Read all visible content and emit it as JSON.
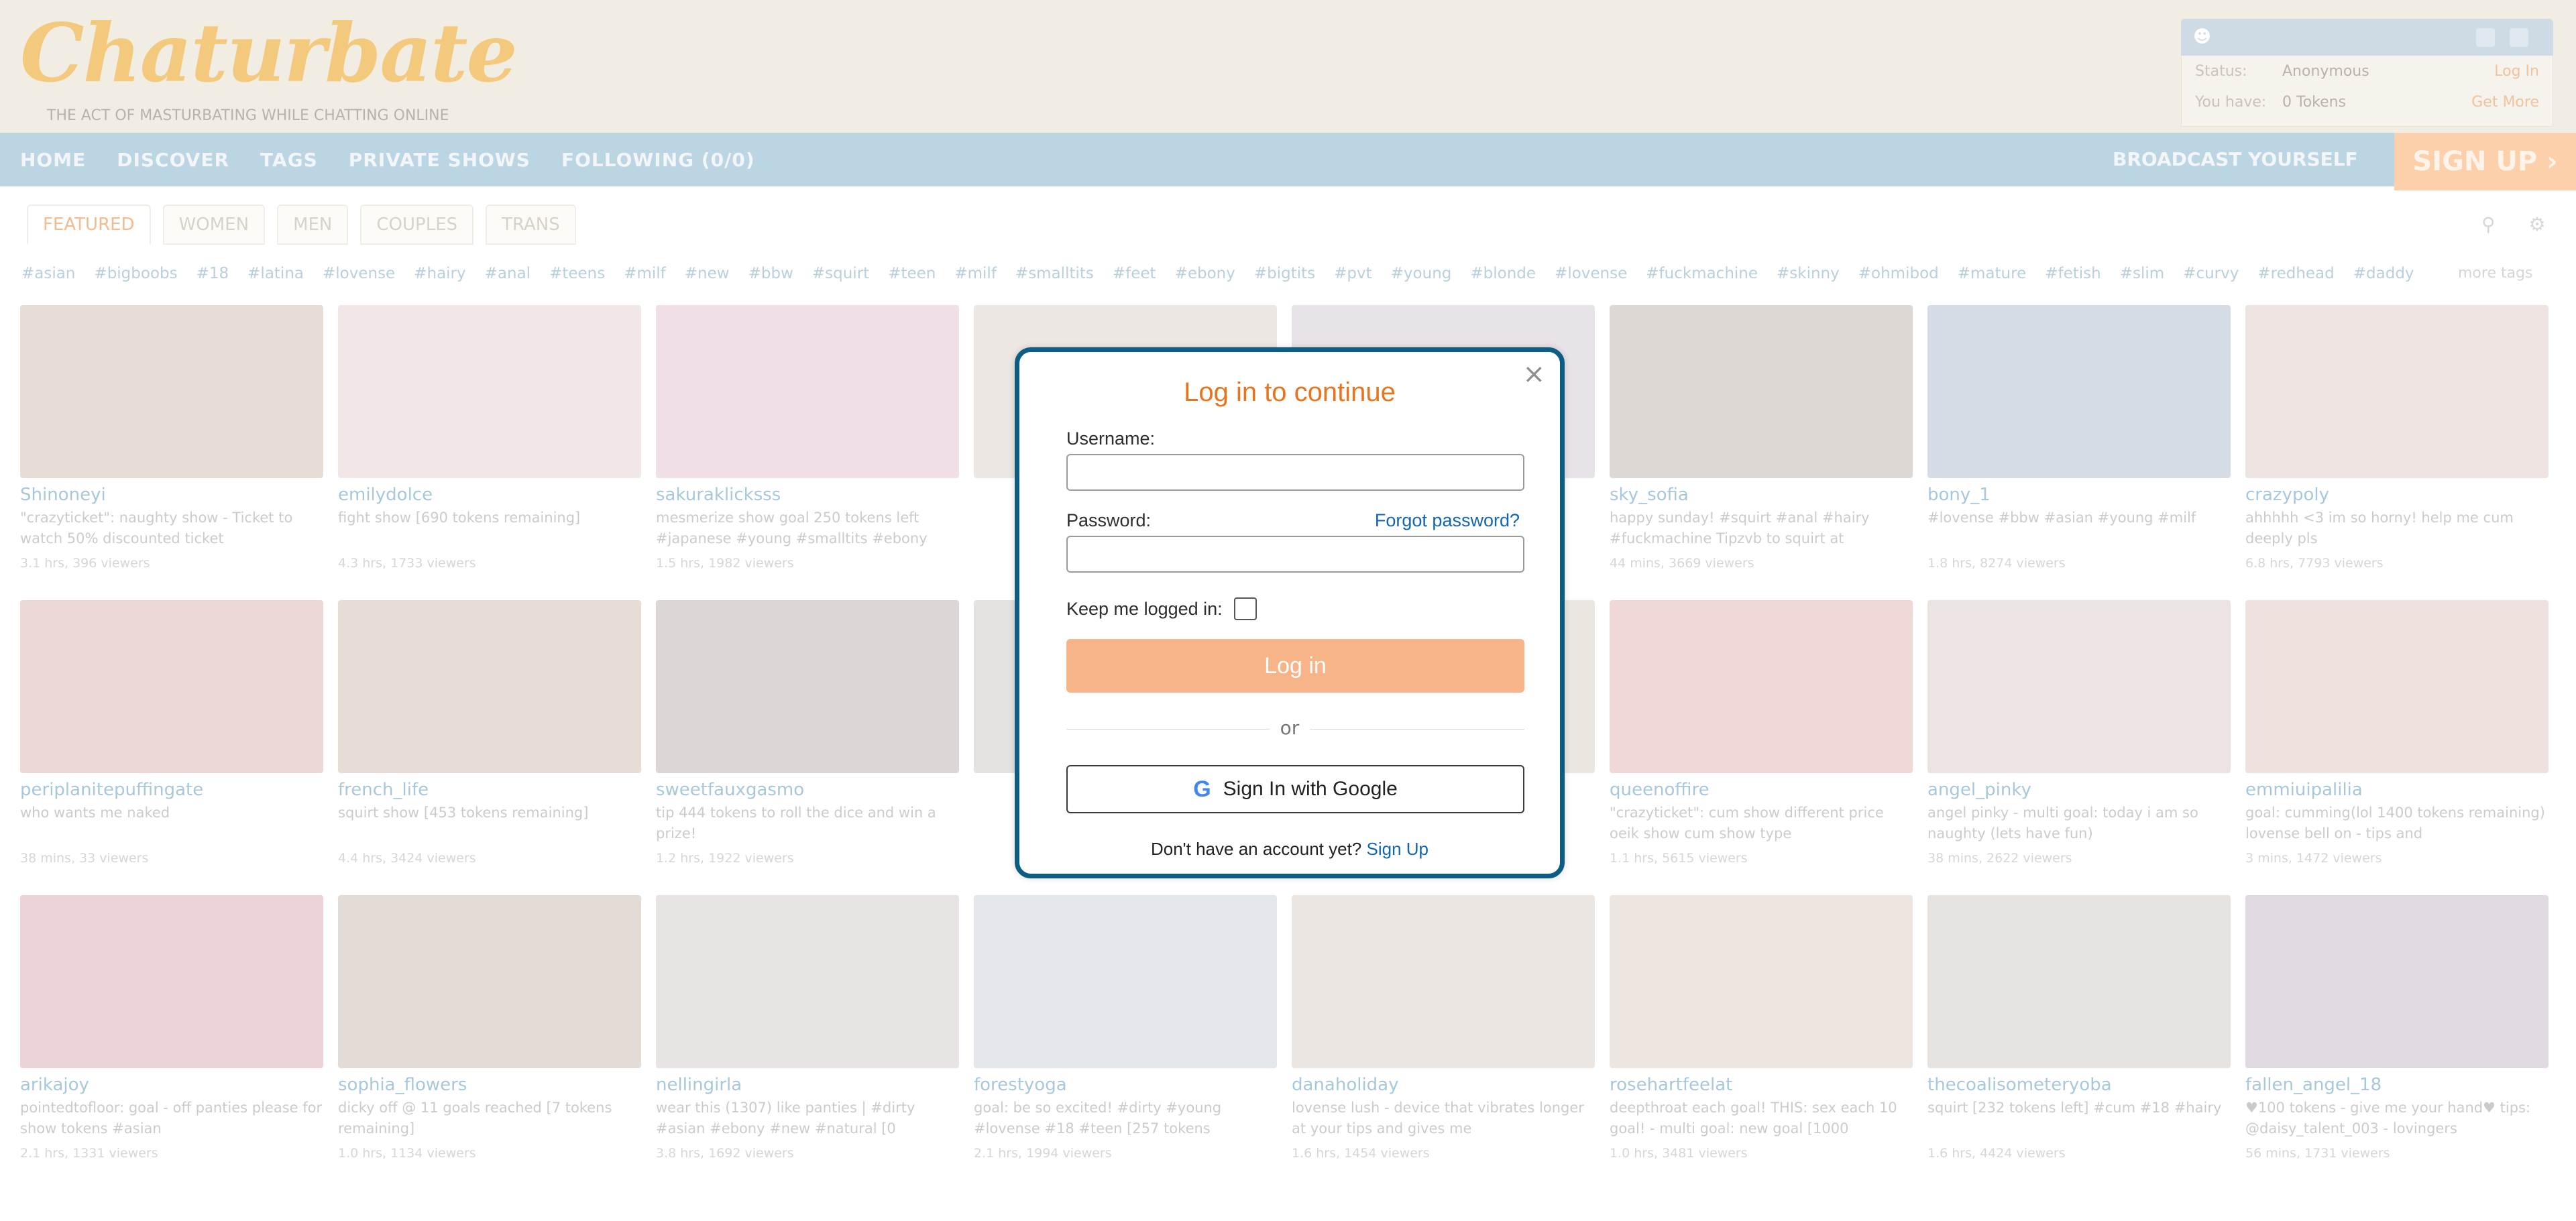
{
  "header": {
    "logo_text": "Chaturbate",
    "logo_sub": "THE ACT OF MASTURBATING WHILE CHATTING ONLINE",
    "user_rows": [
      {
        "label": "Status:",
        "value": "Anonymous",
        "action": "Log In"
      },
      {
        "label": "You have:",
        "value": "0 Tokens",
        "action": "Get More"
      }
    ]
  },
  "nav": {
    "items": [
      "HOME",
      "DISCOVER",
      "TAGS",
      "PRIVATE SHOWS",
      "FOLLOWING (0/0)"
    ],
    "broadcast": "BROADCAST YOURSELF",
    "signup": "SIGN UP ›"
  },
  "tabs": [
    "FEATURED",
    "WOMEN",
    "MEN",
    "COUPLES",
    "TRANS"
  ],
  "tags": [
    "#asian",
    "#bigboobs",
    "#18",
    "#latina",
    "#lovense",
    "#hairy",
    "#anal",
    "#teens",
    "#milf",
    "#new",
    "#bbw",
    "#squirt",
    "#teen",
    "#milf",
    "#smalltits",
    "#feet",
    "#ebony",
    "#bigtits",
    "#pvt",
    "#young",
    "#blonde",
    "#lovense",
    "#fuckmachine",
    "#skinny",
    "#ohmibod",
    "#mature",
    "#fetish",
    "#slim",
    "#curvy",
    "#redhead",
    "#daddy"
  ],
  "tags_more": "more tags",
  "rooms": [
    {
      "name": "Shinoneyi",
      "subj": "\"crazyticket\": naughty show - Ticket to watch 50% discounted ticket",
      "meta": "3.1 hrs, 396 viewers"
    },
    {
      "name": "emilydolce",
      "subj": "fight show [690 tokens remaining]",
      "meta": "4.3 hrs, 1733 viewers"
    },
    {
      "name": "sakuraklicksss",
      "subj": "mesmerize show goal 250 tokens left #japanese #young #smalltits #ebony",
      "meta": "1.5 hrs, 1982 viewers"
    },
    {
      "name": "",
      "subj": "",
      "meta": ""
    },
    {
      "name": "",
      "subj": "",
      "meta": ""
    },
    {
      "name": "sky_sofia",
      "subj": "happy sunday! #squirt #anal #hairy #fuckmachine Tipzvb to squirt at",
      "meta": "44 mins, 3669 viewers"
    },
    {
      "name": "bony_1",
      "subj": "#lovense #bbw #asian #young #milf",
      "meta": "1.8 hrs, 8274 viewers"
    },
    {
      "name": "crazypoly",
      "subj": "ahhhhh <3 im so horny! help me cum deeply pls",
      "meta": "6.8 hrs, 7793 viewers"
    },
    {
      "name": "periplanitepuffingate",
      "subj": "who wants me naked",
      "meta": "38 mins, 33 viewers"
    },
    {
      "name": "french_life",
      "subj": "squirt show [453 tokens remaining]",
      "meta": "4.4 hrs, 3424 viewers"
    },
    {
      "name": "sweetfauxgasmo",
      "subj": "tip 444 tokens to roll the dice and win a prize!",
      "meta": "1.2 hrs, 1922 viewers"
    },
    {
      "name": "",
      "subj": "",
      "meta": ""
    },
    {
      "name": "",
      "subj": "",
      "meta": ""
    },
    {
      "name": "queenoffire",
      "subj": "\"crazyticket\": cum show different price oeik show cum show type",
      "meta": "1.1 hrs, 5615 viewers"
    },
    {
      "name": "angel_pinky",
      "subj": "angel pinky - multi goal: today i am so naughty (lets have fun)",
      "meta": "38 mins, 2622 viewers"
    },
    {
      "name": "emmiuipalilia",
      "subj": "goal: cumming(lol 1400 tokens remaining) lovense bell on - tips and",
      "meta": "3 mins, 1472 viewers"
    },
    {
      "name": "arikajoy",
      "subj": "pointedtofloor: goal - off panties please for show tokens #asian",
      "meta": "2.1 hrs, 1331 viewers"
    },
    {
      "name": "sophia_flowers",
      "subj": "dicky off @ 11 goals reached [7 tokens remaining]",
      "meta": "1.0 hrs, 1134 viewers"
    },
    {
      "name": "nellingirla",
      "subj": "wear this (1307) like panties | #dirty #asian #ebony #new #natural [0",
      "meta": "3.8 hrs, 1692 viewers"
    },
    {
      "name": "forestyoga",
      "subj": "goal: be so excited! #dirty #young #lovense #18 #teen [257 tokens",
      "meta": "2.1 hrs, 1994 viewers"
    },
    {
      "name": "danaholiday",
      "subj": "lovense lush - device that vibrates longer at your tips and gives me",
      "meta": "1.6 hrs, 1454 viewers"
    },
    {
      "name": "rosehartfeelat",
      "subj": "deepthroat each goal! THIS: sex each 10 goal! - multi goal: new goal [1000",
      "meta": "1.0 hrs, 3481 viewers"
    },
    {
      "name": "thecoalisometeryoba",
      "subj": "squirt [232 tokens left] #cum #18 #hairy",
      "meta": "1.6 hrs, 4424 viewers"
    },
    {
      "name": "fallen_angel_18",
      "subj": "♥100 tokens - give me your hand♥ tips: @daisy_talent_003 - lovingers",
      "meta": "56 mins, 1731 viewers"
    }
  ],
  "colors": {
    "modal_border": "#0b5d84",
    "title": "#e9741e",
    "login_btn": "#f7b488",
    "link": "#1166b3"
  },
  "modal": {
    "title": "Log in to continue",
    "username_label": "Username:",
    "password_label": "Password:",
    "forgot": "Forgot password?",
    "keep_label": "Keep me logged in:",
    "login_button": "Log in",
    "or": "or",
    "google_button": "Sign In with Google",
    "signup_prompt": "Don't have an account yet?",
    "signup_link": "Sign Up",
    "close_icon": "close-icon"
  }
}
